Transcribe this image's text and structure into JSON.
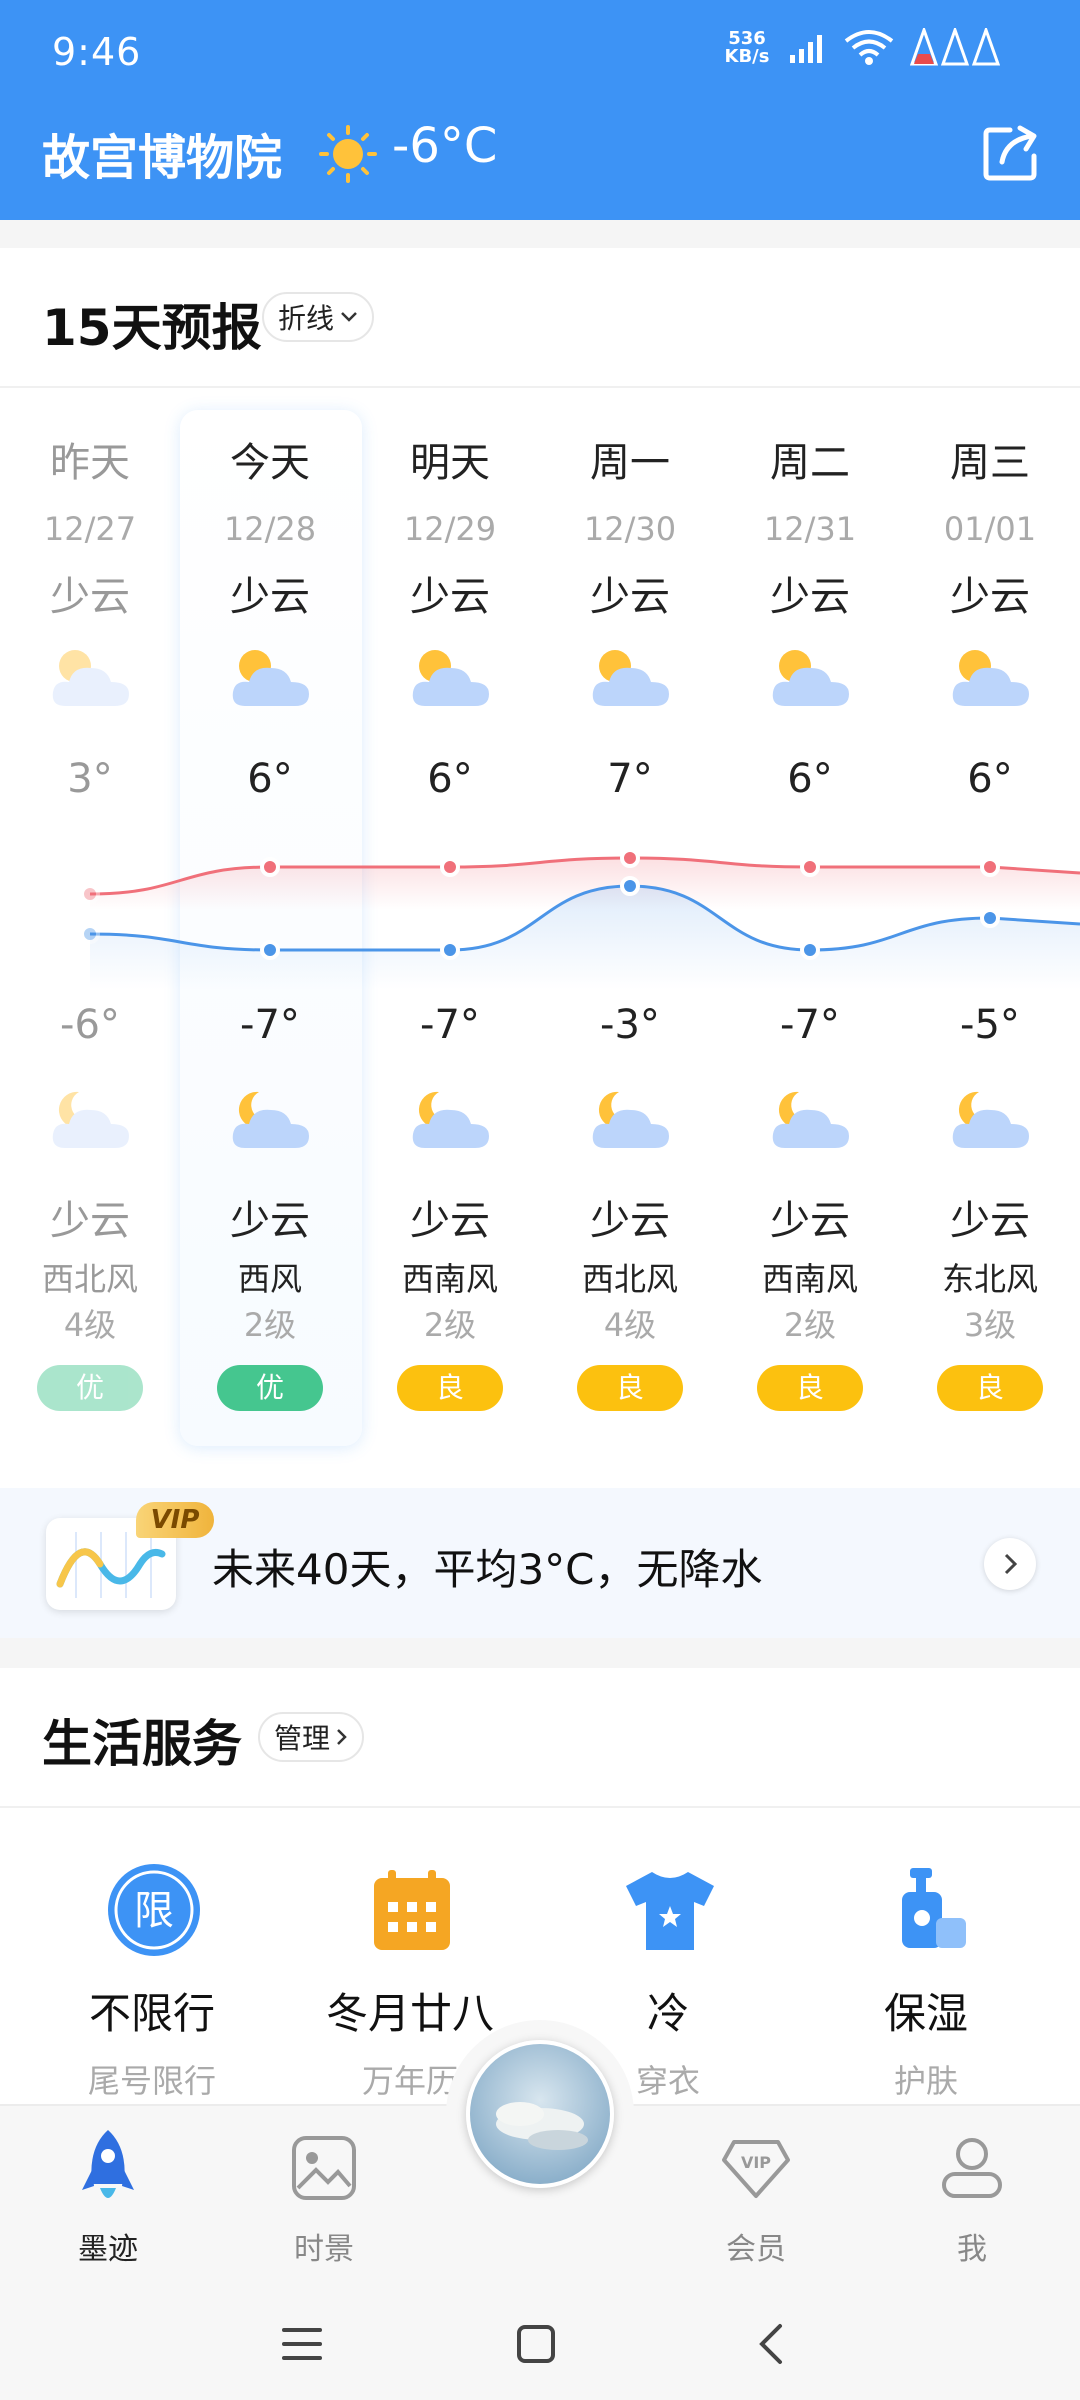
{
  "status_bar": {
    "time": "9:46",
    "net_speed_value": "536",
    "net_speed_unit": "KB/s"
  },
  "header": {
    "location": "故宫博物院",
    "temperature": "-6°C",
    "weather_icon": "sun-icon",
    "share_icon": "share-icon"
  },
  "forecast": {
    "title": "15天预报",
    "view_mode": "折线",
    "days": [
      {
        "day": "昨天",
        "date": "12/27",
        "day_cond": "少云",
        "high": "3°",
        "low": "-6°",
        "night_cond": "少云",
        "wind": "西北风",
        "wind_level": "4级",
        "aqi": "优"
      },
      {
        "day": "今天",
        "date": "12/28",
        "day_cond": "少云",
        "high": "6°",
        "low": "-7°",
        "night_cond": "少云",
        "wind": "西风",
        "wind_level": "2级",
        "aqi": "优"
      },
      {
        "day": "明天",
        "date": "12/29",
        "day_cond": "少云",
        "high": "6°",
        "low": "-7°",
        "night_cond": "少云",
        "wind": "西南风",
        "wind_level": "2级",
        "aqi": "良"
      },
      {
        "day": "周一",
        "date": "12/30",
        "day_cond": "少云",
        "high": "7°",
        "low": "-3°",
        "night_cond": "少云",
        "wind": "西北风",
        "wind_level": "4级",
        "aqi": "良"
      },
      {
        "day": "周二",
        "date": "12/31",
        "day_cond": "少云",
        "high": "6°",
        "low": "-7°",
        "night_cond": "少云",
        "wind": "西南风",
        "wind_level": "2级",
        "aqi": "良"
      },
      {
        "day": "周三",
        "date": "01/01",
        "day_cond": "少云",
        "high": "6°",
        "low": "-5°",
        "night_cond": "少云",
        "wind": "东北风",
        "wind_level": "3级",
        "aqi": "良"
      }
    ],
    "high_values": [
      3,
      6,
      6,
      7,
      6,
      6
    ],
    "low_values": [
      -6,
      -7,
      -7,
      -3,
      -7,
      -5
    ],
    "colors": {
      "good": "#45c68f",
      "moderate": "#fcc10f",
      "high_line": "#f0707a",
      "low_line": "#4b95e8"
    }
  },
  "banner": {
    "vip": "VIP",
    "text": "未来40天，平均3°C，无降水"
  },
  "life": {
    "title": "生活服务",
    "manage": "管理",
    "items": [
      {
        "title": "不限行",
        "sub": "尾号限行",
        "icon": "restriction-icon",
        "icon_char": "限"
      },
      {
        "title": "冬月廿八",
        "sub": "万年历",
        "icon": "calendar-icon"
      },
      {
        "title": "冷",
        "sub": "穿衣",
        "icon": "tshirt-icon"
      },
      {
        "title": "保湿",
        "sub": "护肤",
        "icon": "lotion-icon"
      }
    ]
  },
  "nav": {
    "items": [
      {
        "label": "墨迹",
        "icon": "rocket-icon"
      },
      {
        "label": "时景",
        "icon": "photo-icon"
      },
      {
        "label": "会员",
        "icon": "vip-icon"
      },
      {
        "label": "我",
        "icon": "profile-icon"
      }
    ]
  }
}
